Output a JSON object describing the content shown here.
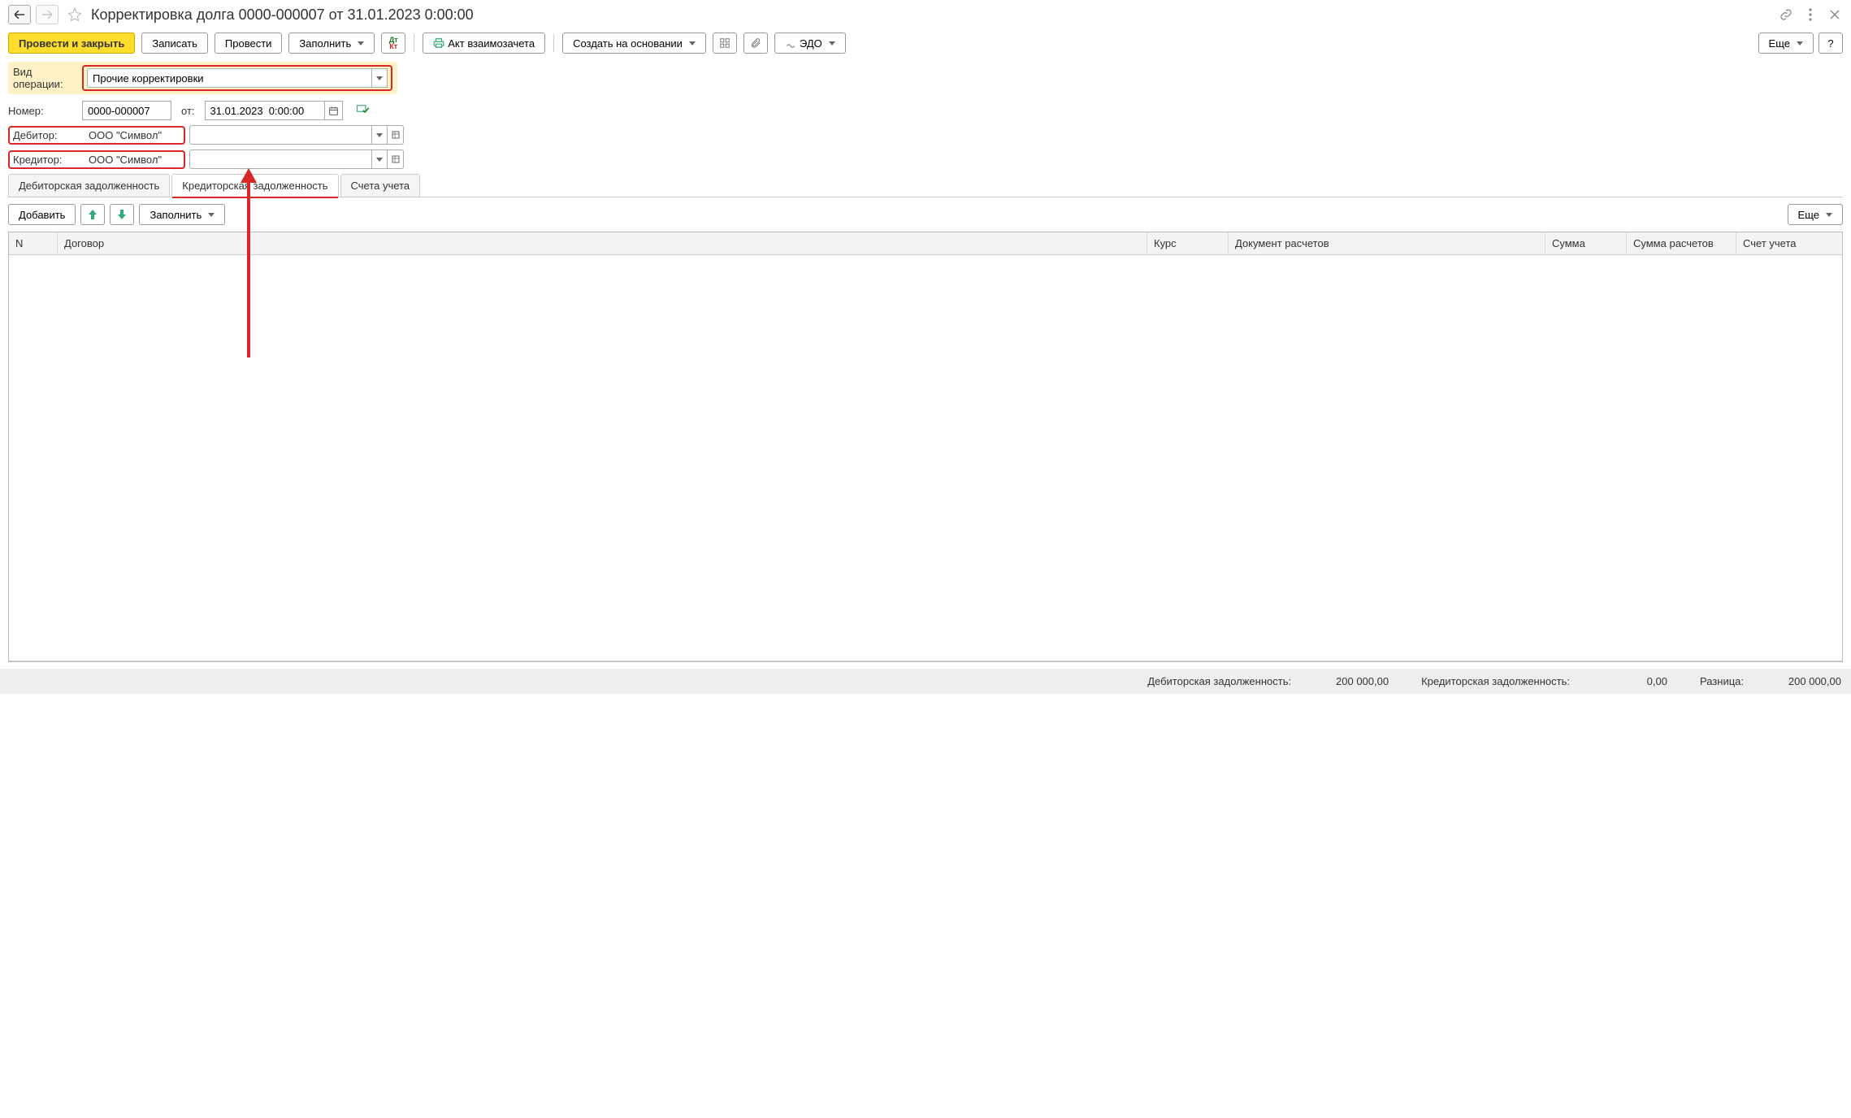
{
  "title": "Корректировка долга 0000-000007 от 31.01.2023 0:00:00",
  "toolbar": {
    "post_close": "Провести и закрыть",
    "save": "Записать",
    "post": "Провести",
    "fill": "Заполнить",
    "offset_act": "Акт взаимозачета",
    "create_based": "Создать на основании",
    "edo": "ЭДО",
    "more": "Еще"
  },
  "fields": {
    "op_type_label": "Вид операции:",
    "op_type_value": "Прочие корректировки",
    "number_label": "Номер:",
    "number_value": "0000-000007",
    "from_label": "от:",
    "date_value": "31.01.2023  0:00:00",
    "debtor_label": "Дебитор:",
    "debtor_value": "ООО \"Символ\"",
    "creditor_label": "Кредитор:",
    "creditor_value": "ООО \"Символ\""
  },
  "tabs": {
    "t1": "Дебиторская задолженность",
    "t2": "Кредиторская задолженность",
    "t3": "Счета учета"
  },
  "tab_toolbar": {
    "add": "Добавить",
    "fill": "Заполнить",
    "more": "Еще"
  },
  "columns": {
    "n": "N",
    "contract": "Договор",
    "rate": "Курс",
    "doc": "Документ расчетов",
    "sum": "Сумма",
    "sum_settle": "Сумма расчетов",
    "account": "Счет учета"
  },
  "status": {
    "debit_label": "Дебиторская задолженность:",
    "debit_value": "200 000,00",
    "credit_label": "Кредиторская задолженность:",
    "credit_value": "0,00",
    "diff_label": "Разница:",
    "diff_value": "200 000,00"
  }
}
